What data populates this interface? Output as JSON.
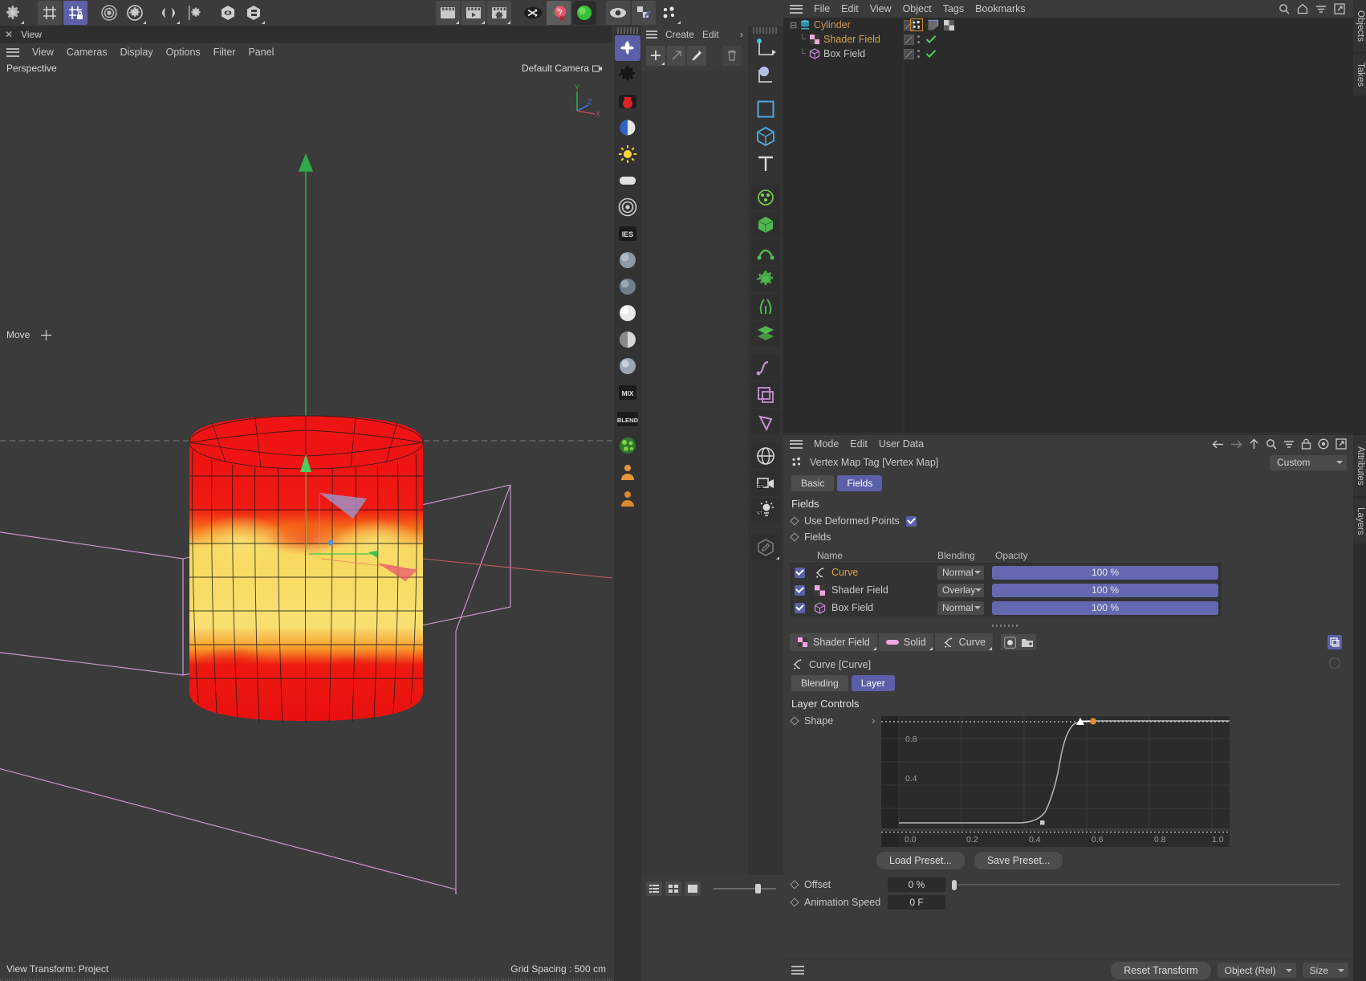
{
  "topbar": {
    "buttons": [
      {
        "name": "settings-gear-icon",
        "label": "Settings"
      },
      {
        "name": "grid-icon",
        "label": "Enable Snapping"
      },
      {
        "name": "grid-lock-icon",
        "label": "Lock Workplane",
        "selected": true
      },
      {
        "name": "target-rings-icon",
        "label": "Quantize"
      },
      {
        "name": "gear-circle-icon",
        "label": "Snap Settings"
      },
      {
        "name": "symmetry-icon",
        "label": "Symmetry"
      },
      {
        "name": "gear-small-icon",
        "label": "Modeling Settings"
      },
      {
        "name": "hex-eye-icon",
        "label": "Viewport Solo"
      },
      {
        "name": "hex-layers-icon",
        "label": "Object Display"
      },
      {
        "name": "clapper-icon",
        "label": "Render View"
      },
      {
        "name": "clapper-play-icon",
        "label": "Render to Picture Viewer"
      },
      {
        "name": "clapper-gear-icon",
        "label": "Render Settings"
      },
      {
        "name": "shuffle-icon",
        "label": "Randomize"
      },
      {
        "name": "help-ball-icon",
        "label": "Help"
      },
      {
        "name": "green-ball-icon",
        "label": "Material Preview"
      },
      {
        "name": "eye-icon",
        "label": "Visibility"
      },
      {
        "name": "pin-checker-icon",
        "label": "Pin Texture"
      },
      {
        "name": "vertex-map-icon",
        "label": "Vertex Map"
      }
    ]
  },
  "viewport": {
    "tab_close": "✕",
    "tab_label": "View",
    "menus": [
      "View",
      "Cameras",
      "Display",
      "Options",
      "Filter",
      "Panel"
    ],
    "projection": "Perspective",
    "camera": "Default Camera",
    "tool_badge": "Move",
    "view_transform": "View Transform: Project",
    "grid_spacing": "Grid Spacing : 500 cm",
    "axis_labels": {
      "x": "X",
      "y": "Y",
      "z": "Z"
    }
  },
  "viewport_strip": {
    "buttons": [
      {
        "name": "deformer-icon",
        "selected": true
      },
      {
        "name": "gear-icon",
        "selected": false
      },
      {
        "name": "camera-red-icon",
        "selected": false
      },
      {
        "name": "contrast-circle-icon",
        "selected": false
      },
      {
        "name": "sun-light-icon",
        "selected": false
      },
      {
        "name": "area-light-icon",
        "selected": false
      },
      {
        "name": "target-light-icon",
        "selected": false
      },
      {
        "name": "ies-light-icon",
        "selected": false
      },
      {
        "name": "sphere-material-icon",
        "selected": false
      },
      {
        "name": "sphere-material-2-icon",
        "selected": false
      },
      {
        "name": "sphere-material-3-icon",
        "selected": false
      },
      {
        "name": "sphere-material-4-icon",
        "selected": false
      },
      {
        "name": "sphere-material-5-icon",
        "selected": false
      },
      {
        "name": "mix-node-icon",
        "selected": false
      },
      {
        "name": "blend-node-icon",
        "selected": false
      },
      {
        "name": "noise-green-icon",
        "selected": false
      },
      {
        "name": "character-orange-icon",
        "selected": false
      },
      {
        "name": "character-orange-2-icon",
        "selected": false
      }
    ],
    "ies_label": "IES",
    "mix_label": "MIX",
    "blend_label": "BLEND"
  },
  "material_panel": {
    "menus": [
      "Create",
      "Edit"
    ],
    "overflow": "›",
    "tools": [
      {
        "name": "add-material-button",
        "glyph": "+"
      },
      {
        "name": "apply-material-button",
        "glyph": "↗"
      },
      {
        "name": "pick-material-button",
        "glyph": "eyedropper"
      },
      {
        "name": "delete-material-button",
        "glyph": "trash"
      }
    ],
    "bottom_buttons": [
      {
        "name": "list-view-button"
      },
      {
        "name": "grid-view-button"
      },
      {
        "name": "large-view-button"
      }
    ]
  },
  "object_icons_column": {
    "buttons": [
      {
        "name": "move-axis-icon"
      },
      {
        "name": "sphere-axis-icon"
      },
      {
        "name": "rectangle-blue-icon"
      },
      {
        "name": "cube-blue-icon"
      },
      {
        "name": "text-tool-icon"
      },
      {
        "name": "particle-icon"
      },
      {
        "name": "green-cube-icon"
      },
      {
        "name": "deform-icon"
      },
      {
        "name": "gear-green-icon"
      },
      {
        "name": "hair-icon"
      },
      {
        "name": "layers-green-icon"
      },
      {
        "name": "spline-purple-icon"
      },
      {
        "name": "plane-purple-icon"
      },
      {
        "name": "polygon-purple-icon"
      },
      {
        "name": "global-sim-icon"
      },
      {
        "name": "stage-camera-icon"
      },
      {
        "name": "stage-light-icon"
      },
      {
        "name": "annotation-icon"
      }
    ]
  },
  "object_manager": {
    "menus": [
      "File",
      "Edit",
      "View",
      "Object",
      "Tags",
      "Bookmarks"
    ],
    "right_icons": [
      "search-icon",
      "home-icon",
      "filter-icon",
      "external-link-icon"
    ],
    "items": [
      {
        "name": "Cylinder",
        "depth": 0,
        "color": "#d79553",
        "icon": "cylinder-icon",
        "has_expander": true,
        "expander": "⊟",
        "visible_dot": true,
        "tags": [
          "vertex-map-tag",
          "selection-tag",
          "checker-tag"
        ],
        "check": false
      },
      {
        "name": "Shader Field",
        "depth": 1,
        "color": "#d6a24a",
        "icon": "shader-field-icon",
        "has_expander": false,
        "visible_dot": true,
        "tags": [],
        "check": true
      },
      {
        "name": "Box Field",
        "depth": 1,
        "color": "#c4c4c4",
        "icon": "box-field-icon",
        "has_expander": false,
        "visible_dot": true,
        "tags": [],
        "check": true
      }
    ]
  },
  "attributes": {
    "menus": [
      "Mode",
      "Edit",
      "User Data"
    ],
    "right_icons": [
      "arrow-left-icon",
      "arrow-right-icon",
      "arrow-up-icon",
      "search-icon",
      "filter-icon",
      "lock-icon",
      "target-icon",
      "external-link-icon"
    ],
    "object_title": "Vertex Map Tag [Vertex Map]",
    "object_icon": "vertex-map-icon",
    "preset_value": "Custom",
    "tabs": [
      {
        "label": "Basic",
        "active": false
      },
      {
        "label": "Fields",
        "active": true
      }
    ],
    "section_title": "Fields",
    "use_deformed_points": {
      "label": "Use Deformed Points",
      "checked": true
    },
    "fields_label": "Fields",
    "table": {
      "headers": [
        "Name",
        "Blending",
        "Opacity"
      ],
      "rows": [
        {
          "enabled": true,
          "icon": "curve-icon",
          "name": "Curve",
          "name_color": "#e0a33c",
          "blending": "Normal",
          "opacity": "100 %"
        },
        {
          "enabled": true,
          "icon": "shader-field-icon",
          "name": "Shader Field",
          "name_color": "#c8c8c8",
          "blending": "Overlay",
          "opacity": "100 %"
        },
        {
          "enabled": true,
          "icon": "box-field-icon",
          "name": "Box Field",
          "name_color": "#c8c8c8",
          "blending": "Normal",
          "opacity": "100 %"
        }
      ]
    },
    "chips": [
      {
        "label": "Shader Field",
        "icon": "shader-field-icon"
      },
      {
        "label": "Solid",
        "icon": "solid-icon"
      },
      {
        "label": "Curve",
        "icon": "curve-icon"
      }
    ],
    "chip_buttons": [
      {
        "name": "record-layer-button",
        "icon": "record-icon"
      },
      {
        "name": "add-folder-button",
        "icon": "folder-plus-icon"
      }
    ],
    "layer_title": "Curve [Curve]",
    "layer_tabs": [
      {
        "label": "Blending",
        "active": false
      },
      {
        "label": "Layer",
        "active": true
      }
    ],
    "layer_controls_title": "Layer Controls",
    "shape_label": "Shape",
    "shape_expander": "›",
    "buttons": {
      "load_preset": "Load Preset...",
      "save_preset": "Save Preset..."
    },
    "offset": {
      "label": "Offset",
      "value": "0 %"
    },
    "animation_speed": {
      "label": "Animation Speed",
      "value": "0 F"
    }
  },
  "chart_data": {
    "type": "line",
    "title": "Shape",
    "xlabel": "",
    "ylabel": "",
    "xlim": [
      0.0,
      1.0
    ],
    "ylim": [
      0.0,
      1.0
    ],
    "xticks": [
      "0.0",
      "0.2",
      "0.4",
      "0.6",
      "0.8",
      "1.0"
    ],
    "yticks": [
      "0.4",
      "0.8"
    ],
    "grid": true,
    "legend": "none",
    "series": [
      {
        "name": "Curve",
        "color": "#b9b9b9",
        "x": [
          0.0,
          0.2,
          0.35,
          0.42,
          0.44,
          0.46,
          0.5,
          0.53,
          0.55,
          0.7,
          1.0
        ],
        "y": [
          0.0,
          0.0,
          0.0,
          0.02,
          0.1,
          0.35,
          0.8,
          0.95,
          1.0,
          1.0,
          1.0
        ]
      }
    ],
    "knots": [
      {
        "x": 0.44,
        "y": 0.0,
        "type": "square",
        "color": "#b9b9b9"
      },
      {
        "x": 0.555,
        "y": 1.0,
        "type": "circle",
        "color": "#e09030"
      }
    ],
    "handle": {
      "x": 0.5,
      "y": 1.0,
      "type": "triangle",
      "color": "#ffffff"
    }
  },
  "bottom_bar": {
    "reset_transform": "Reset Transform",
    "mode_combo": "Object (Rel)",
    "size_combo": "Size"
  },
  "right_tabs": [
    {
      "label": "Objects"
    },
    {
      "label": "Takes"
    },
    {
      "label": "Attributes"
    },
    {
      "label": "Layers"
    }
  ],
  "colors": {
    "accent": "#5a5fa8",
    "panel": "#3b3b3b",
    "dark_panel": "#2b2b2b",
    "cylinder_red": "#ee1d1d",
    "cylinder_yellow": "#f5e06a",
    "field_wire": "#d79bd7",
    "axis_green": "#2faa49"
  }
}
